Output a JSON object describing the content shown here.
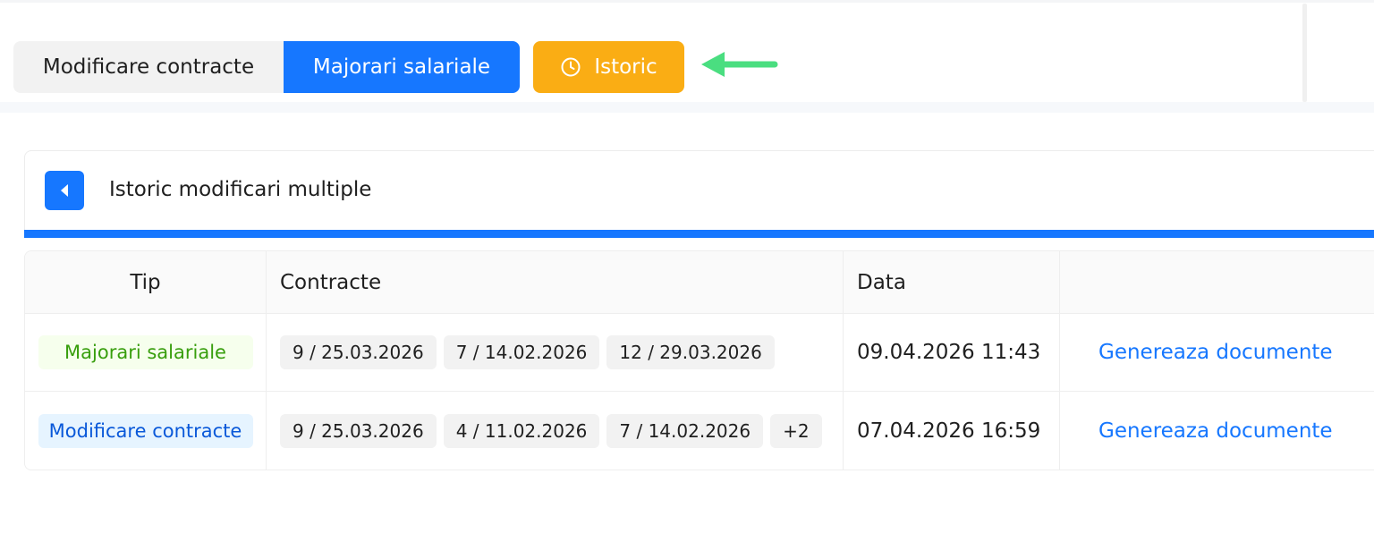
{
  "colors": {
    "primary": "#1677ff",
    "warning": "#faad14",
    "arrow": "#4ade80",
    "tag_green_bg": "#f6ffed",
    "tag_green_text": "#389e0d",
    "tag_blue_bg": "#e6f4ff",
    "tag_blue_text": "#0958d9"
  },
  "toolbar": {
    "segments": [
      {
        "label": "Modificare contracte",
        "active": false
      },
      {
        "label": "Majorari salariale",
        "active": true
      }
    ],
    "history_button": {
      "label": "Istoric",
      "icon": "clock-icon"
    },
    "annotation_icon": "arrow-left-icon"
  },
  "panel": {
    "back_icon": "caret-left-icon",
    "title": "Istoric modificari multiple"
  },
  "table": {
    "columns": [
      "Tip",
      "Contracte",
      "Data",
      ""
    ],
    "rows": [
      {
        "tip": "Majorari salariale",
        "tip_color": "green",
        "contracts": [
          "9 / 25.03.2026",
          "7 / 14.02.2026",
          "12 / 29.03.2026"
        ],
        "more": "",
        "date": "09.04.2026 11:43",
        "action": "Genereaza documente"
      },
      {
        "tip": "Modificare contracte",
        "tip_color": "blue",
        "contracts": [
          "9 / 25.03.2026",
          "4 / 11.02.2026",
          "7 / 14.02.2026"
        ],
        "more": "+2",
        "date": "07.04.2026 16:59",
        "action": "Genereaza documente"
      }
    ]
  }
}
